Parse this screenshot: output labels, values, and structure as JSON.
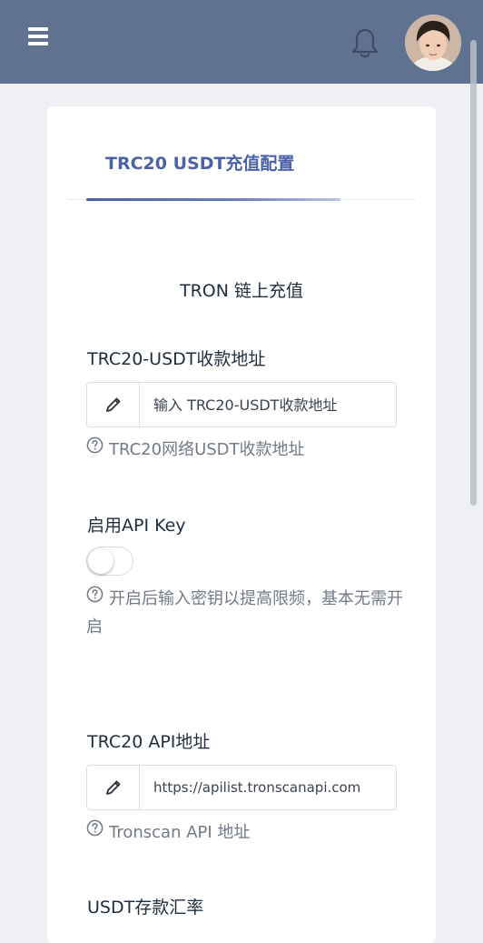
{
  "header": {
    "menu_icon": "hamburger-menu-icon",
    "bell_icon": "bell-icon",
    "avatar": "user-avatar"
  },
  "card": {
    "tab_label": "TRC20 USDT充值配置",
    "section_title": "TRON 链上充值",
    "fields": [
      {
        "label": "TRC20-USDT收款地址",
        "value": "",
        "placeholder": "输入 TRC20-USDT收款地址",
        "help": "TRC20网络USDT收款地址"
      },
      {
        "label": "启用API Key",
        "toggle_on": false,
        "help": "开启后输入密钥以提高限频，基本无需开启"
      },
      {
        "label": "TRC20 API地址",
        "value": "https://apilist.tronscanapi.com",
        "placeholder": "",
        "help": "Tronscan API 地址"
      },
      {
        "label": "USDT存款汇率"
      }
    ]
  },
  "colors": {
    "header_bg": "#5f7290",
    "accent": "#4b63a6",
    "text": "#1f2d3d",
    "help_text": "#737a86"
  }
}
